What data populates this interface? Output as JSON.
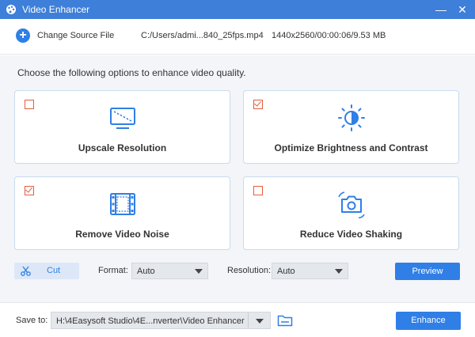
{
  "window": {
    "title": "Video Enhancer",
    "minimize_glyph": "—",
    "close_glyph": "✕"
  },
  "source": {
    "add_glyph": "+",
    "change_label": "Change Source File",
    "file_path": "C:/Users/admi...840_25fps.mp4",
    "file_info": "1440x2560/00:00:06/9.53 MB"
  },
  "prompt": "Choose the following options to enhance video quality.",
  "options": [
    {
      "label": "Upscale Resolution",
      "checked": false,
      "icon": "upscale-icon"
    },
    {
      "label": "Optimize Brightness and Contrast",
      "checked": true,
      "icon": "brightness-icon"
    },
    {
      "label": "Remove Video Noise",
      "checked": true,
      "icon": "film-icon"
    },
    {
      "label": "Reduce Video Shaking",
      "checked": false,
      "icon": "camera-shake-icon"
    }
  ],
  "controls": {
    "cut_label": "Cut",
    "format_label": "Format:",
    "format_value": "Auto",
    "resolution_label": "Resolution:",
    "resolution_value": "Auto",
    "preview_label": "Preview"
  },
  "save": {
    "label": "Save to:",
    "path": "H:\\4Easysoft Studio\\4E...nverter\\Video Enhancer",
    "enhance_label": "Enhance"
  },
  "colors": {
    "accent": "#2f7fe6",
    "titlebar": "#3d7fd9",
    "checkbox": "#e65c3c"
  }
}
